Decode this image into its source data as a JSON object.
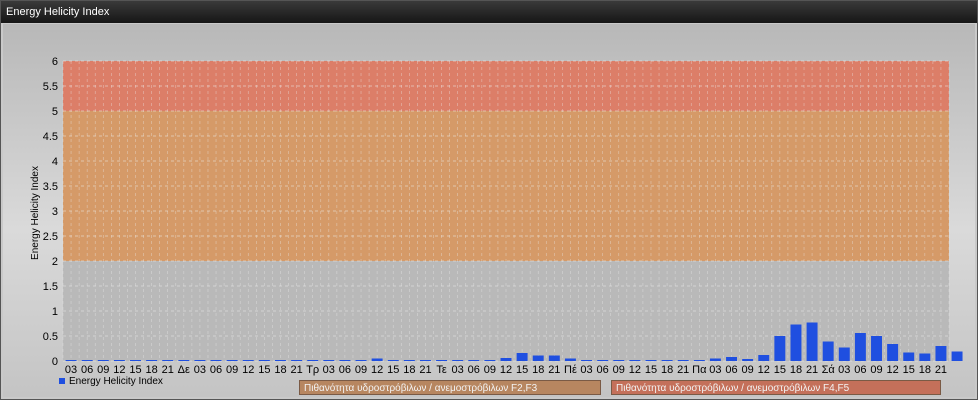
{
  "window": {
    "title": "Energy Helicity Index"
  },
  "legend": {
    "series_label": "Energy Helicity Index"
  },
  "zones": [
    {
      "label": "Πιθανότητα υδροστρόβιλων / ανεμοστρόβιλων F2,F3",
      "color": "#b78660"
    },
    {
      "label": "Πιθανότητα υδροστρόβιλων / ανεμοστρόβιλων F4,F5",
      "color": "#c4705a"
    }
  ],
  "chart_data": {
    "type": "bar",
    "ylabel": "Energy Helicity Index",
    "ylim": [
      0,
      6
    ],
    "yticks": [
      "0",
      "0.5",
      "1",
      "1.5",
      "2",
      "2.5",
      "3",
      "3.5",
      "4",
      "4.5",
      "5",
      "5.5",
      "6"
    ],
    "bands": [
      {
        "from": 0,
        "to": 2,
        "color": "#b9b9b9"
      },
      {
        "from": 2,
        "to": 5,
        "color": "#d59a68"
      },
      {
        "from": 5,
        "to": 6,
        "color": "#dc7e68"
      }
    ],
    "bar_color": "#1f4fe0",
    "categories": [
      "03",
      "06",
      "09",
      "12",
      "15",
      "18",
      "21",
      "Δε",
      "03",
      "06",
      "09",
      "12",
      "15",
      "18",
      "21",
      "Τρ",
      "03",
      "06",
      "09",
      "12",
      "15",
      "18",
      "21",
      "Τε",
      "03",
      "06",
      "09",
      "12",
      "15",
      "18",
      "21",
      "Πέ",
      "03",
      "06",
      "09",
      "12",
      "15",
      "18",
      "21",
      "Πα",
      "03",
      "06",
      "09",
      "12",
      "15",
      "18",
      "21",
      "Σά",
      "03",
      "06",
      "09",
      "12",
      "15",
      "18",
      "21"
    ],
    "series": [
      {
        "name": "Energy Helicity Index",
        "values": [
          0.01,
          0.01,
          0.01,
          0.02,
          0.02,
          0.01,
          0.01,
          0.01,
          0.01,
          0.01,
          0.01,
          0.01,
          0.01,
          0.01,
          0.01,
          0.01,
          0.01,
          0.01,
          0.02,
          0.05,
          0.02,
          0.01,
          0.01,
          0.01,
          0.01,
          0.01,
          0.01,
          0.06,
          0.16,
          0.11,
          0.11,
          0.05,
          0.02,
          0.01,
          0.02,
          0.01,
          0.01,
          0.01,
          0.01,
          0.01,
          0.05,
          0.08,
          0.04,
          0.12,
          0.5,
          0.73,
          0.77,
          0.39,
          0.27,
          0.56,
          0.5,
          0.34,
          0.17,
          0.15,
          0.3,
          0.19
        ]
      }
    ]
  }
}
